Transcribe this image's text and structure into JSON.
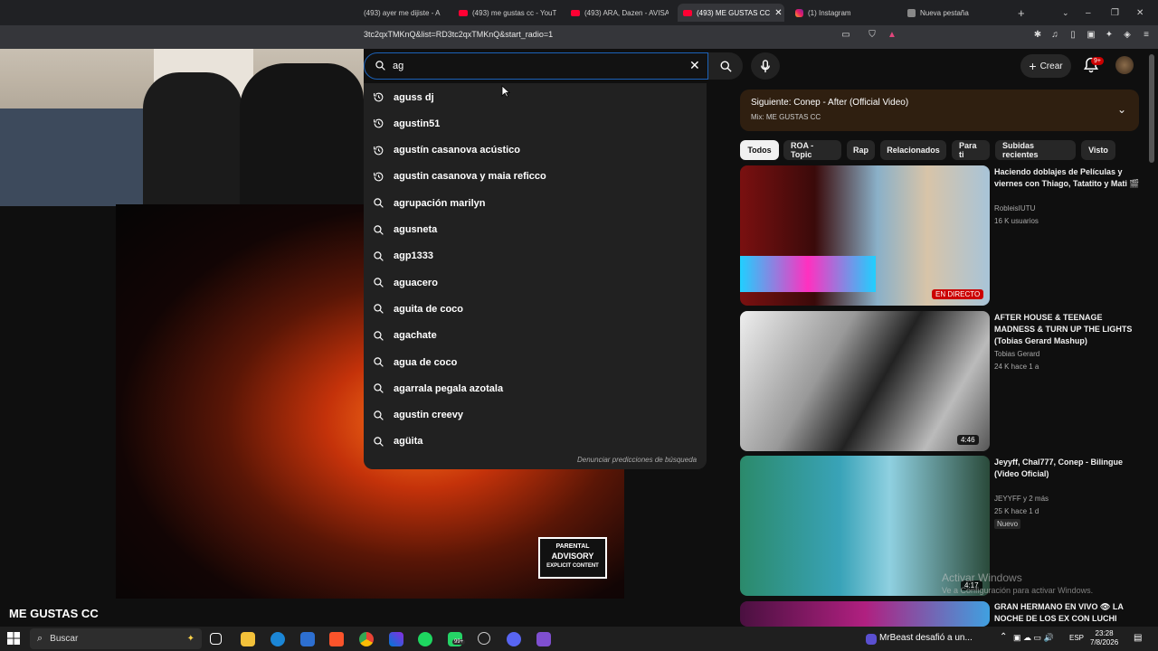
{
  "browser": {
    "tabs": [
      {
        "label": "(493) ayer me dijiste - A",
        "icon": "youtube-icon"
      },
      {
        "label": "(493) me gustas cc - YouT",
        "icon": "youtube-icon"
      },
      {
        "label": "(493) ARA, Dazen - AVISA",
        "icon": "youtube-icon"
      },
      {
        "label": "(493) ME GUSTAS CC",
        "icon": "youtube-icon",
        "active": true
      },
      {
        "label": "(1) Instagram",
        "icon": "instagram-icon"
      },
      {
        "label": "Nueva pestaña",
        "icon": "brave-icon"
      }
    ],
    "new_tab": "+",
    "url": "3tc2qxTMKnQ&list=RD3tc2qxTMKnQ&start_radio=1"
  },
  "player": {
    "video_title": "ME GUSTAS CC",
    "advisory": {
      "line1": "PARENTAL",
      "line2": "ADVISORY",
      "line3": "EXPLICIT CONTENT"
    }
  },
  "search": {
    "query": "ag",
    "suggestions": [
      {
        "text": "aguss dj",
        "kind": "history"
      },
      {
        "text": "agustin51",
        "kind": "history"
      },
      {
        "text": "agustín casanova acústico",
        "kind": "history"
      },
      {
        "text": "agustin casanova y maia reficco",
        "kind": "history"
      },
      {
        "text": "agrupación marilyn",
        "kind": "search"
      },
      {
        "text": "agusneta",
        "kind": "search"
      },
      {
        "text": "agp1333",
        "kind": "search"
      },
      {
        "text": "aguacero",
        "kind": "search"
      },
      {
        "text": "aguita de coco",
        "kind": "search"
      },
      {
        "text": "agachate",
        "kind": "search"
      },
      {
        "text": "agua de coco",
        "kind": "search"
      },
      {
        "text": "agarrala pegala azotala",
        "kind": "search"
      },
      {
        "text": "agustin creevy",
        "kind": "search"
      },
      {
        "text": "agüita",
        "kind": "search"
      }
    ],
    "report_link": "Denunciar predicciones de búsqueda"
  },
  "header": {
    "create_label": "Crear",
    "notifications_badge": "9+"
  },
  "up_next": {
    "main": "Siguiente: Conep - After (Official Video)",
    "sub": "Mix: ME GUSTAS CC"
  },
  "chips": [
    "Todos",
    "ROA - Topic",
    "Rap",
    "Relacionados",
    "Para ti",
    "Subidas recientes",
    "Visto"
  ],
  "videos": [
    {
      "title": "Haciendo doblajes de Películas y viernes con Thiago, Tatatito y Mati 🎬",
      "channel": "RobleisIUTU",
      "meta": "16 K usuarios",
      "badge": "EN DIRECTO"
    },
    {
      "title": "AFTER HOUSE & TEENAGE MADNESS & TURN UP THE LIGHTS (Tobias Gerard Mashup)",
      "channel": "Tobias Gerard",
      "meta": "24 K   hace 1 a",
      "badge": "4:46"
    },
    {
      "title": "Jeyyff, Chal777, Conep - Bilingue (Video Oficial)",
      "channel": "JEYYFF y 2 más",
      "meta": "25 K   hace 1 d",
      "tag": "Nuevo",
      "badge": "4:17"
    },
    {
      "title": "GRAN HERMANO EN VIVO 👁 LA NOCHE DE LOS EX CON LUCHI",
      "channel": "",
      "meta": ""
    }
  ],
  "watermark": {
    "line1": "Activar Windows",
    "line2": "Ve a Configuración para activar Windows."
  },
  "taskbar": {
    "search_placeholder": "Buscar",
    "news": "MrBeast desafió a un...",
    "lang": "ESP",
    "time": "23:28",
    "date": "7/8/2026",
    "spotify_badge": "99+"
  }
}
